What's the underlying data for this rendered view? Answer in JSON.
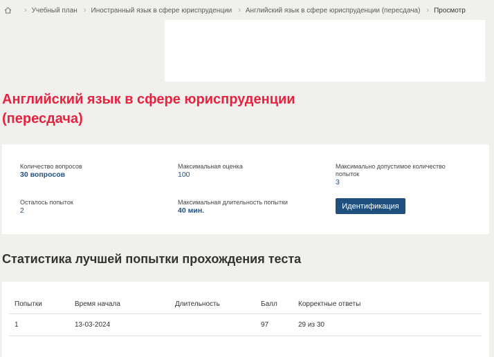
{
  "breadcrumb": {
    "home_icon": "home-icon",
    "items": [
      "Учебный план",
      "Иностранный язык в сфере юриспруденции",
      "Английский язык в сфере юриспруденции (пересдача)"
    ],
    "current": "Просмотр"
  },
  "page": {
    "title_line1": "Английский язык в сфере юриспруденции",
    "title_line2": "(пересдача)"
  },
  "info": {
    "questions_label": "Количество вопросов",
    "questions_value": "30 вопросов",
    "max_score_label": "Максимальная оценка",
    "max_score_value": "100",
    "max_attempts_label_line1": "Максимально допустимое количество",
    "max_attempts_label_line2": "попыток",
    "max_attempts_value": "3",
    "remaining_label": "Осталось попыток",
    "remaining_value": "2",
    "max_duration_label": "Максимальная длительность попытки",
    "max_duration_value": "40 мин.",
    "identify_button": "Идентификация"
  },
  "stats": {
    "title": "Статистика лучшей попытки прохождения теста",
    "headers": [
      "Попытки",
      "Время начала",
      "Длительность",
      "Балл",
      "Корректные ответы"
    ],
    "rows": [
      [
        "1",
        "13-03-2024",
        "",
        "97",
        "29 из 30"
      ]
    ]
  },
  "colors": {
    "accent_red": "#e8213f",
    "primary_blue": "#1f4f7f",
    "background": "#f2f0ed"
  }
}
